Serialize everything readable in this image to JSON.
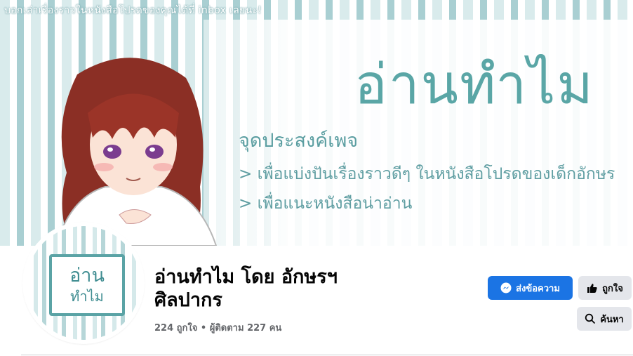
{
  "cover": {
    "top_note": "บอกเล่าเรื่องราวในหนังสือโปรดของคุณได้ที่ inbox เลยนะ!",
    "title": "อ่านทำไม",
    "purpose_heading": "จุดประสงค์เพจ",
    "bullets": [
      "> เพื่อแบ่งปันเรื่องราวดีๆ ในหนังสือโปรดของเด็กอักษร",
      "> เพื่อแนะหนังสือน่าอ่าน"
    ]
  },
  "avatar": {
    "line1": "อ่าน",
    "line2": "ทำไม"
  },
  "page": {
    "name": "อ่านทำไม โดย อักษรฯ ศิลปากร",
    "stats": "224 ถูกใจ • ผู้ติดตาม 227 คน"
  },
  "actions": {
    "message_label": "ส่งข้อความ",
    "like_label": "ถูกใจ",
    "search_label": "ค้นหา"
  },
  "colors": {
    "accent": "#1b74e4",
    "secondary_button": "#e4e6eb",
    "cover_teal": "#5aa6a6"
  },
  "icons": {
    "message": "messenger-icon",
    "like": "thumbs-up-icon",
    "search": "search-icon"
  }
}
